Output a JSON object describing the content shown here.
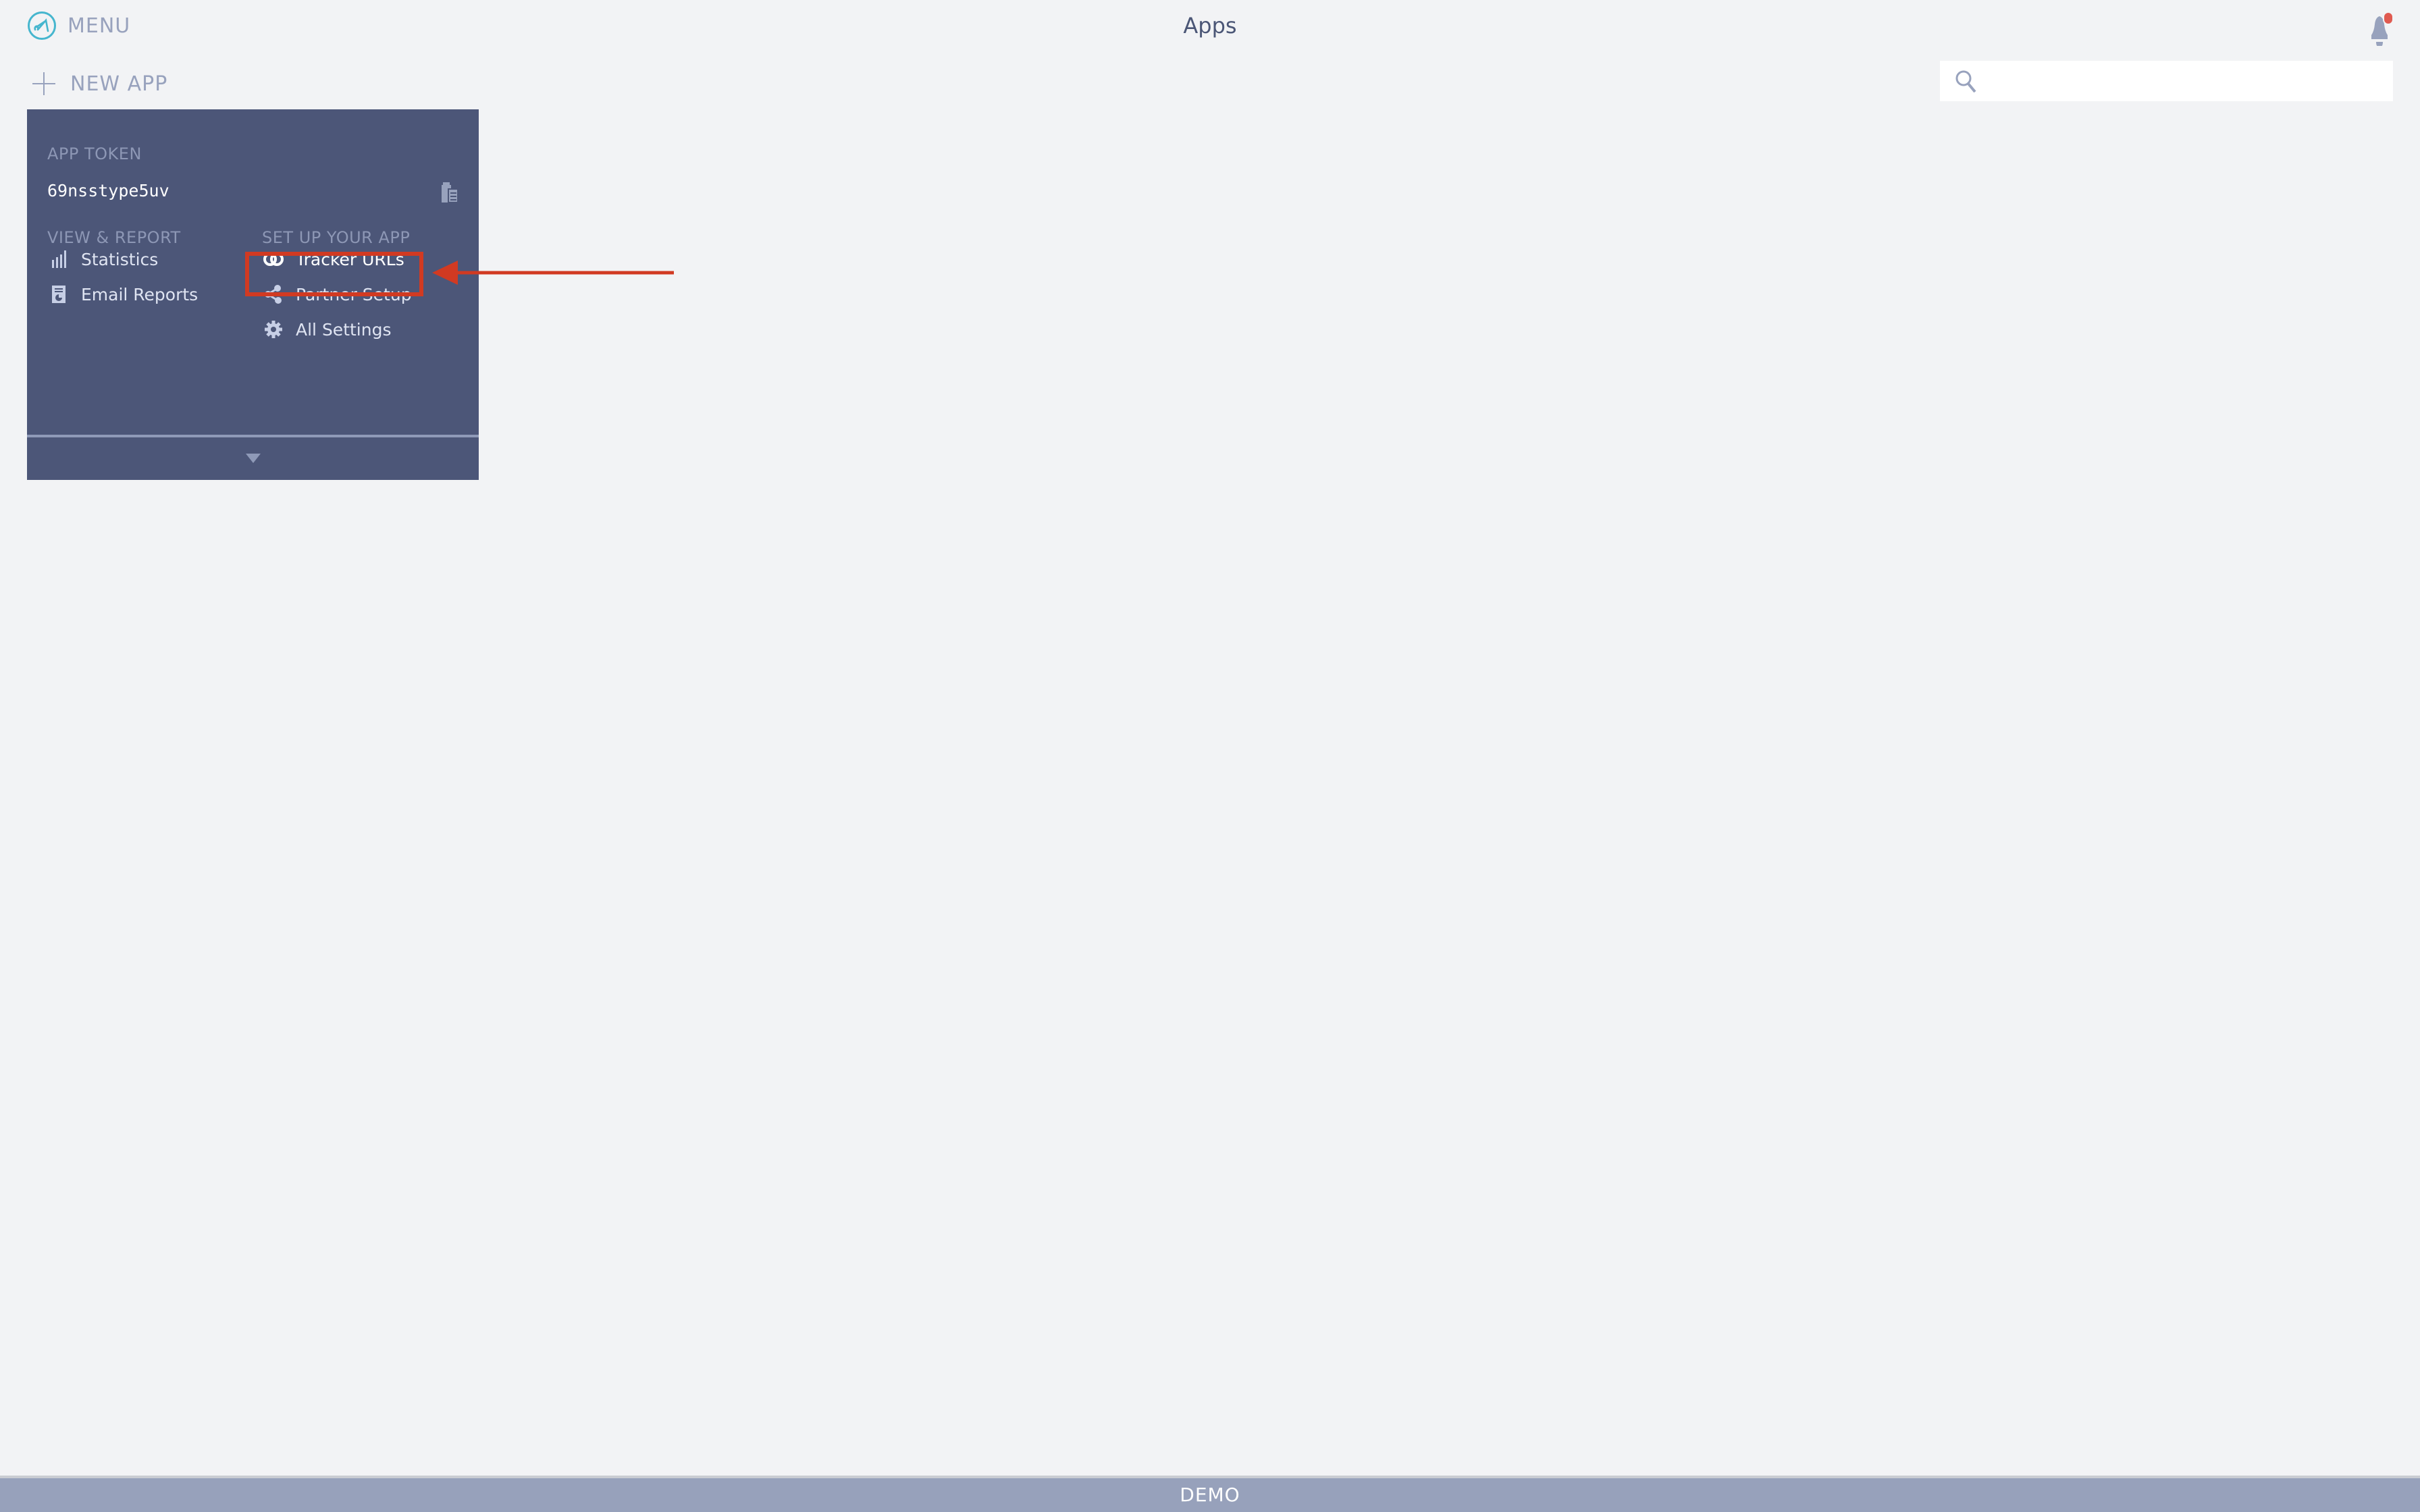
{
  "header": {
    "menu_label": "MENU",
    "title": "Apps",
    "notification_badge_color": "#e05a50"
  },
  "toolbar": {
    "new_app_label": "NEW APP",
    "search": {
      "value": "",
      "placeholder": ""
    }
  },
  "app_card": {
    "token_label": "APP TOKEN",
    "token_value": "69nsstype5uv",
    "view_report": {
      "heading": "VIEW & REPORT",
      "items": [
        {
          "label": "Statistics",
          "icon": "bar-chart-icon"
        },
        {
          "label": "Email Reports",
          "icon": "report-icon"
        }
      ]
    },
    "setup": {
      "heading": "SET UP YOUR APP",
      "items": [
        {
          "label": "Tracker URLs",
          "icon": "link-icon"
        },
        {
          "label": "Partner Setup",
          "icon": "share-icon"
        },
        {
          "label": "All Settings",
          "icon": "gear-icon"
        }
      ]
    },
    "background_color": "#4c5678"
  },
  "annotation": {
    "highlighted_item": "Tracker URLs",
    "color": "#d13a22"
  },
  "footer": {
    "label": "DEMO"
  }
}
